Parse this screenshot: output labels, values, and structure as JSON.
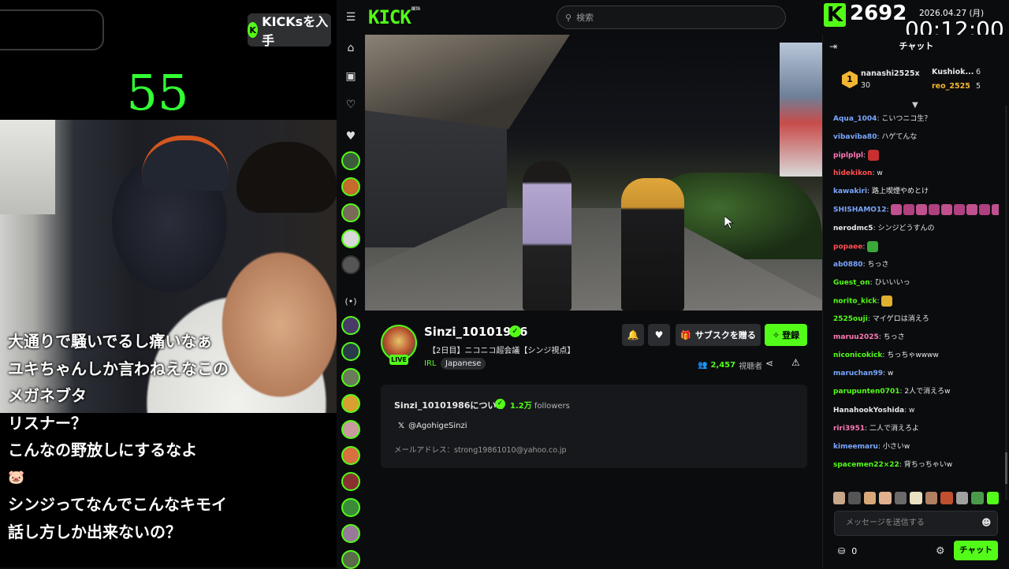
{
  "overlay": {
    "kicks_button": "KICKsを入手",
    "counter": "55",
    "comments": [
      "大通りで騒いでるし痛いなぁ",
      "ユキちゃんしか言わねえなこの",
      "メガネブタ",
      "リスナー？",
      "こんなの野放しにするなよ",
      "🐷",
      "シンジってなんでこんなキモイ",
      "話し方しか出来ないの？"
    ]
  },
  "header": {
    "logo": "KICK",
    "logo_badge": "BETA",
    "search_placeholder": "検索"
  },
  "topbar": {
    "k_badge": "K",
    "kick_count": "2692",
    "date": "2026.04.27 (月)",
    "time": "00:12:00"
  },
  "stream": {
    "channel_name": "Sinzi_10101986",
    "live_badge": "LIVE",
    "title": "【2日目】ニコニコ超会議【シンジ視点】",
    "category": "IRL",
    "language": "Japanese",
    "gift_sub_label": "サブスクを贈る",
    "subscribe_label": "登録",
    "viewers": "2,457",
    "viewers_suffix": "視聴者"
  },
  "about": {
    "title": "Sinzi_10101986について",
    "followers_count": "1.2万",
    "followers_label": "followers",
    "x_handle": "@AgohigeSinzi",
    "email": "メールアドレス：strong19861010@yahoo.co.jp"
  },
  "chat": {
    "header": "チャット",
    "top_gifter_rank": "1",
    "gifters": [
      {
        "name": "nanashi2525x",
        "count": "30"
      },
      {
        "name": "Kushiok...",
        "count": "6"
      },
      {
        "name": "reo_2525",
        "count": "5"
      }
    ],
    "messages": [
      {
        "user": "Aqua_1004",
        "text": "こいつニコ生？",
        "color": "#7aa7ff"
      },
      {
        "user": "vibaviba80",
        "text": "ハゲてんな",
        "color": "#7aa7ff"
      },
      {
        "user": "piplplpl",
        "text": "",
        "color": "#ff7ab6"
      },
      {
        "user": "hidekikon",
        "text": "w",
        "color": "#ff5050"
      },
      {
        "user": "kawakiri",
        "text": "路上喫煙やめとけ",
        "color": "#7aa7ff"
      },
      {
        "user": "SHISHAMO12",
        "text": "",
        "color": "#7aa7ff"
      },
      {
        "user": "nerodmc5",
        "text": "シンジどうすんの",
        "color": "#e8e8e8"
      },
      {
        "user": "popaee",
        "text": "",
        "color": "#ff5050"
      },
      {
        "user": "ab0880",
        "text": "ちっさ",
        "color": "#7aa7ff"
      },
      {
        "user": "Guest_on",
        "text": "ひいいいっ",
        "color": "#53fc18"
      },
      {
        "user": "norito_kick",
        "text": "",
        "color": "#53fc18"
      },
      {
        "user": "2525ouji",
        "text": "マイゲロは消えろ",
        "color": "#53fc18"
      },
      {
        "user": "maruu2025",
        "text": "ちっさ",
        "color": "#ff7ab6"
      },
      {
        "user": "niconicokick",
        "text": "ちっちゃwwww",
        "color": "#53fc18"
      },
      {
        "user": "maruchan99",
        "text": "w",
        "color": "#7aa7ff"
      },
      {
        "user": "parupunten0701",
        "text": "2人で消えろw",
        "color": "#53fc18"
      },
      {
        "user": "HanahookYoshida",
        "text": "w",
        "color": "#e8e8e8"
      },
      {
        "user": "riri3951",
        "text": "二人で消えろよ",
        "color": "#ff7ab6"
      },
      {
        "user": "kimeemaru",
        "text": "小さいw",
        "color": "#7aa7ff"
      },
      {
        "user": "spacemen22×22",
        "text": "背ちっちゃいw",
        "color": "#53fc18"
      }
    ],
    "input_placeholder": "メッセージを送信する",
    "points": "0",
    "send_label": "チャット"
  }
}
